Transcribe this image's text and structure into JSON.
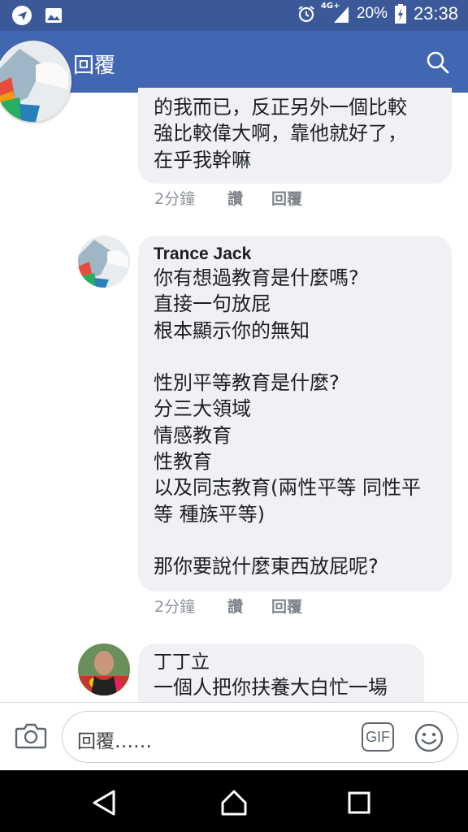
{
  "status_bar": {
    "signal_label": "4G+",
    "battery": "20%",
    "time": "23:38"
  },
  "header": {
    "title": "回覆"
  },
  "comments": [
    {
      "lines": [
        "的我而已，反正另外一個比較",
        "強比較偉大啊，靠他就好了，",
        "在乎我幹嘛"
      ],
      "time": "2分鐘",
      "like": "讚",
      "reply": "回覆"
    },
    {
      "author": "Trance Jack",
      "lines": [
        "你有想過教育是什麼嗎?",
        "直接一句放屁",
        "根本顯示你的無知",
        "",
        "性別平等教育是什麼?",
        "分三大領域",
        "情感教育",
        "性教育",
        "以及同志教育(兩性平等 同性平",
        "等 種族平等)",
        "",
        "那你要說什麼東西放屁呢?"
      ],
      "time": "2分鐘",
      "like": "讚",
      "reply": "回覆"
    },
    {
      "author": "丁丁立",
      "lines": [
        "一個人把你扶養大白忙一場"
      ]
    }
  ],
  "reply_bar": {
    "placeholder": "回覆……",
    "gif_label": "GIF"
  }
}
